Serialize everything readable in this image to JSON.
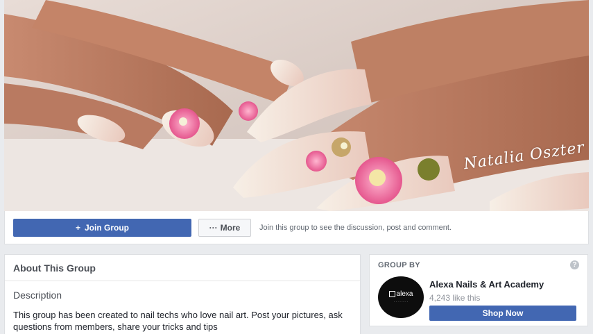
{
  "cover": {
    "watermark": "Natalia Oszter"
  },
  "actions": {
    "join_label": "Join Group",
    "join_icon": "+",
    "more_label": "More",
    "more_icon": "···",
    "hint": "Join this group to see the discussion, post and comment."
  },
  "about": {
    "title": "About This Group",
    "description_title": "Description",
    "description_text": "This group has been created to nail techs who love nail art. Post your pictures, ask questions from members, share your tricks and tips"
  },
  "group_by": {
    "title": "GROUP BY",
    "help_icon": "?",
    "page_name": "Alexa Nails & Art Academy",
    "likes": "4,243 like this",
    "shop_label": "Shop Now",
    "logo_text": "alexa"
  },
  "colors": {
    "brand_blue": "#4267b2",
    "page_bg": "#e9ebee"
  }
}
